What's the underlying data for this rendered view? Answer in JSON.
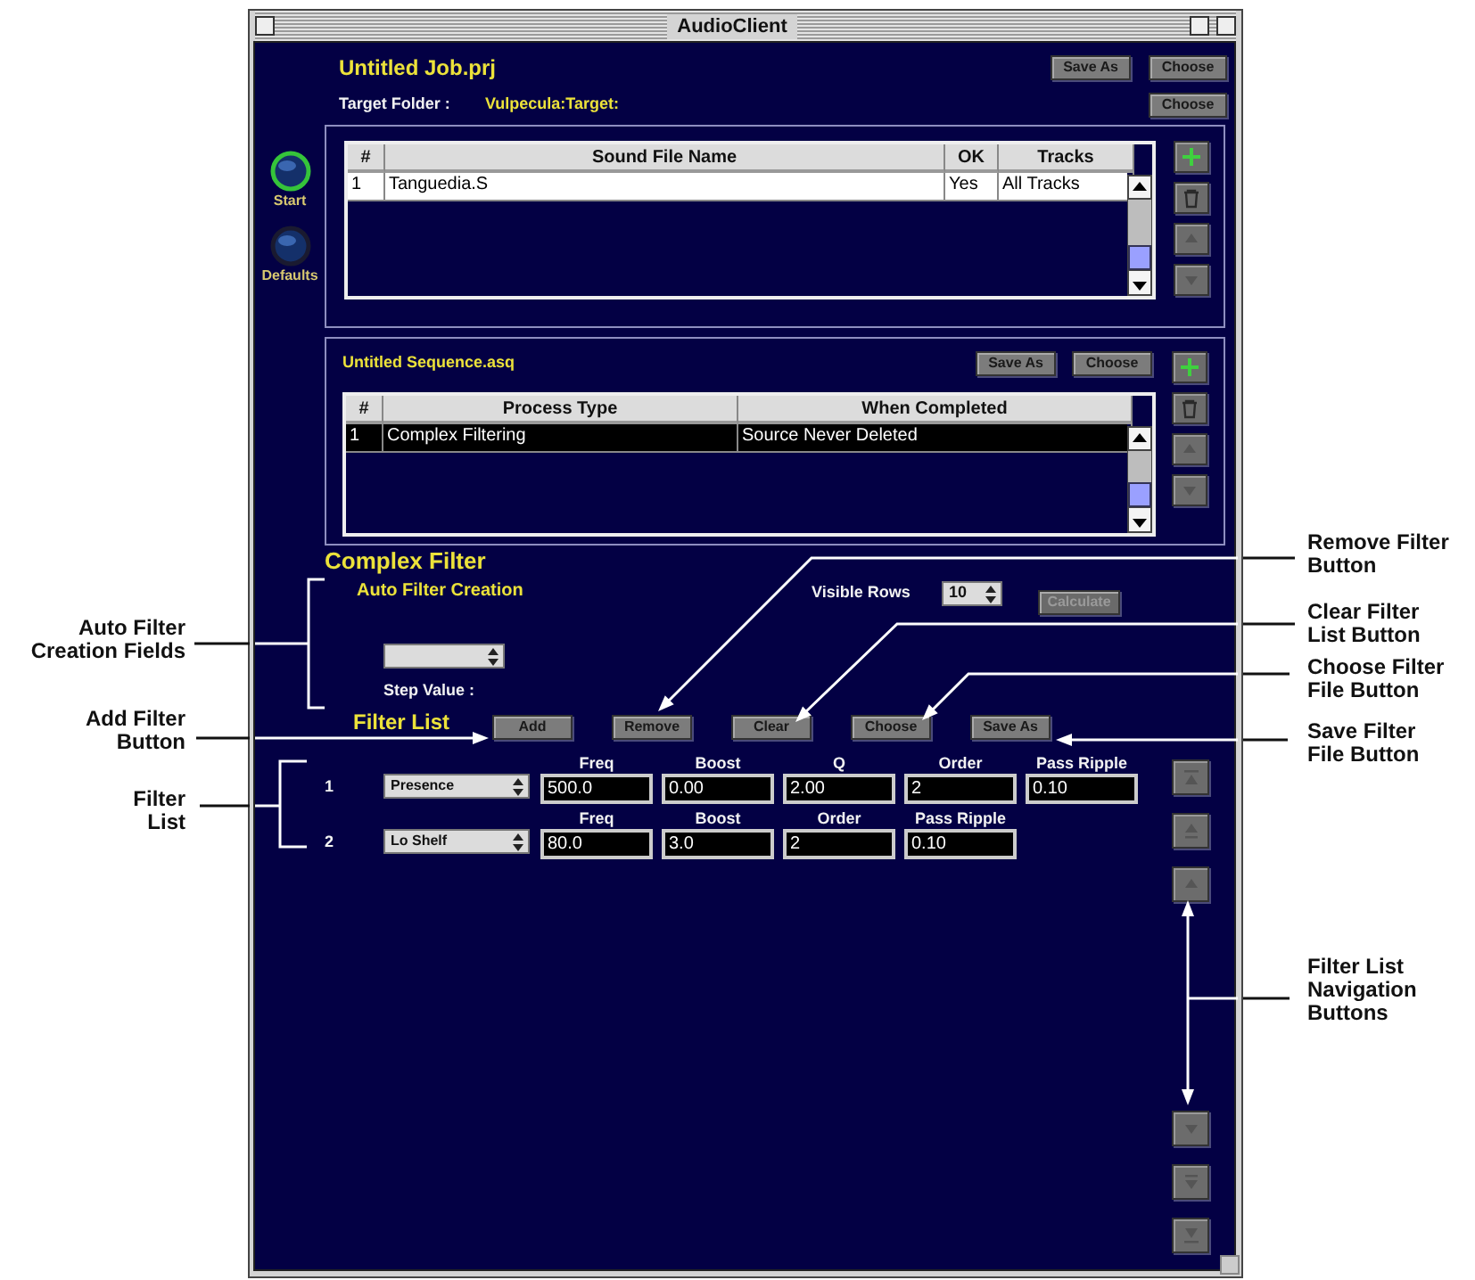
{
  "window": {
    "title": "AudioClient"
  },
  "sidebar": [
    {
      "label": "Start",
      "highlighted": true
    },
    {
      "label": "Defaults",
      "highlighted": false
    }
  ],
  "job": {
    "title": "Untitled Job.prj",
    "buttons": [
      "Save As",
      "Choose"
    ],
    "target_label": "Target Folder :",
    "target_path": "Vulpecula:Target:",
    "target_button": "Choose"
  },
  "sound_files": {
    "columns": [
      "#",
      "Sound File Name",
      "OK",
      "Tracks"
    ],
    "rows": [
      {
        "cells": [
          "1",
          "Tanguedia.S",
          "Yes",
          "All Tracks"
        ],
        "selected": false
      }
    ]
  },
  "sequence": {
    "title": "Untitled Sequence.asq",
    "buttons": [
      "Save As",
      "Choose"
    ],
    "columns": [
      "#",
      "Process Type",
      "When Completed"
    ],
    "rows": [
      {
        "cells": [
          "1",
          "Complex Filtering",
          "Source Never Deleted"
        ],
        "selected": true
      }
    ]
  },
  "complex_filter": {
    "title": "Complex Filter",
    "auto_title": "Auto Filter Creation",
    "visible_rows_label": "Visible Rows",
    "visible_rows": "10",
    "calculate": {
      "label": "Calculate",
      "disabled": true
    },
    "step_value_label": "Step Value :",
    "list_title": "Filter List",
    "buttons": [
      "Add",
      "Remove",
      "Clear",
      "Choose",
      "Save As"
    ],
    "filters": [
      {
        "index": "1",
        "type": "Presence",
        "params": [
          {
            "label": "Freq",
            "value": "500.0"
          },
          {
            "label": "Boost",
            "value": "0.00"
          },
          {
            "label": "Q",
            "value": "2.00"
          },
          {
            "label": "Order",
            "value": "2"
          },
          {
            "label": "Pass Ripple",
            "value": "0.10"
          }
        ]
      },
      {
        "index": "2",
        "type": "Lo Shelf",
        "params": [
          {
            "label": "Freq",
            "value": "80.0"
          },
          {
            "label": "Boost",
            "value": "3.0"
          },
          {
            "label": "Order",
            "value": "2"
          },
          {
            "label": "Pass Ripple",
            "value": "0.10"
          }
        ]
      }
    ]
  },
  "annotations": [
    {
      "text": "Auto Filter Creation Fields"
    },
    {
      "text": "Add Filter Button"
    },
    {
      "text": "Filter List"
    },
    {
      "text": "Remove Filter Button"
    },
    {
      "text": "Clear Filter List Button"
    },
    {
      "text": "Choose Filter File Button"
    },
    {
      "text": "Save Filter File Button"
    },
    {
      "text": "Filter List Navigation Buttons"
    }
  ]
}
